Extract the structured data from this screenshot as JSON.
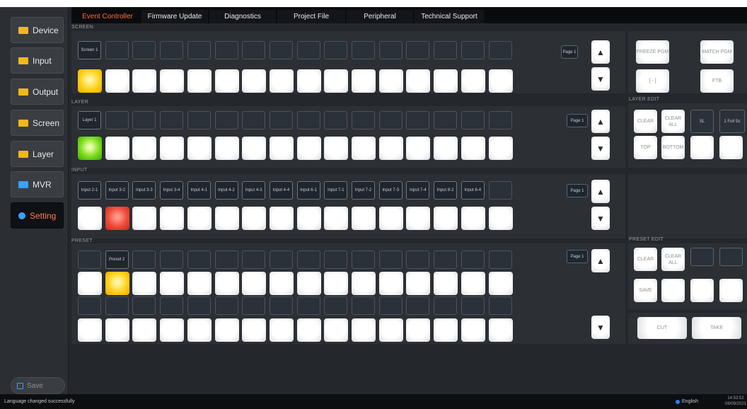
{
  "sidebar": {
    "items": [
      {
        "label": "Device",
        "icon": "device-icon",
        "color": "#f0b81a"
      },
      {
        "label": "Input",
        "icon": "input-icon",
        "color": "#f0b81a"
      },
      {
        "label": "Output",
        "icon": "output-icon",
        "color": "#f0b81a"
      },
      {
        "label": "Screen",
        "icon": "screen-icon",
        "color": "#f0b81a"
      },
      {
        "label": "Layer",
        "icon": "layer-icon",
        "color": "#f0b81a"
      },
      {
        "label": "MVR",
        "icon": "mvr-icon",
        "color": "#3aa0ff"
      },
      {
        "label": "Setting",
        "icon": "gear-icon",
        "color": "#3aa0ff",
        "active": true
      }
    ],
    "save_label": "Save"
  },
  "tabs": [
    "Event Controller",
    "Firmware Update",
    "Diagnostics",
    "Project File",
    "Peripheral",
    "Technical Support"
  ],
  "screen": {
    "label": "SCREEN",
    "slots": [
      "Screen 1",
      "",
      "",
      "",
      "",
      "",
      "",
      "",
      "",
      "",
      "",
      "",
      "",
      "",
      "",
      ""
    ],
    "page": "Page 1"
  },
  "layer": {
    "label": "LAYER",
    "slots": [
      "Layer 1",
      "",
      "",
      "",
      "",
      "",
      "",
      "",
      "",
      "",
      "",
      "",
      "",
      "",
      "",
      ""
    ],
    "page": "Page 1"
  },
  "input": {
    "label": "INPUT",
    "slots": [
      "Input 2-1",
      "Input 3-2",
      "Input 3-3",
      "Input 3-4",
      "Input 4-1",
      "Input 4-2",
      "Input 4-3",
      "Input 4-4",
      "Input 6-1",
      "Input 7-1",
      "Input 7-2",
      "Input 7-3",
      "Input 7-4",
      "Input 8-2",
      "Input 8-4",
      ""
    ],
    "page": "Page 1"
  },
  "preset": {
    "label": "PRESET",
    "slots": [
      "",
      "Preset 2",
      "",
      "",
      "",
      "",
      "",
      "",
      "",
      "",
      "",
      "",
      "",
      "",
      "",
      ""
    ],
    "page": "Page 1"
  },
  "controls": {
    "freeze": "FREEZE PGM",
    "match": "MATCH PGM",
    "bracket": "[ - ]",
    "ftb": "FTB",
    "layer_edit_label": "LAYER EDIT",
    "layer_clear": "CLEAR",
    "layer_clear_all": "CLEAR ALL",
    "layer_sl": "SL",
    "layer_full": "1 Full Sc",
    "layer_top": "TOP",
    "layer_bottom": "BOTTOM",
    "preset_edit_label": "PRESET EDIT",
    "preset_clear": "CLEAR",
    "preset_clear_all": "CLEAR ALL",
    "preset_save": "SAVE",
    "cut": "CUT",
    "take": "TAKE"
  },
  "status": {
    "message": "Language changed successfully",
    "language": "English",
    "time": "14:53:52",
    "date": "06/09/2021"
  }
}
